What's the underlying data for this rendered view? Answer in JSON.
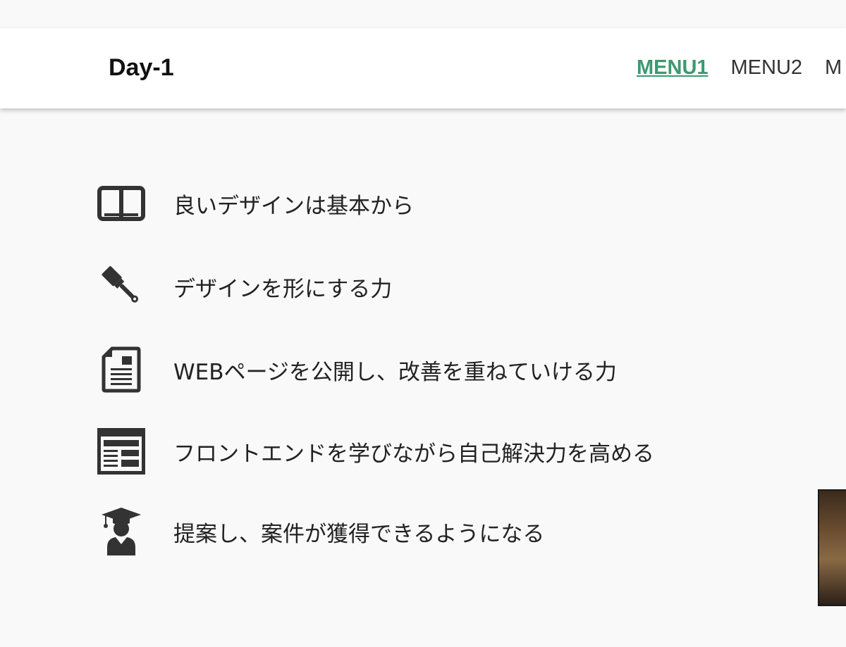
{
  "header": {
    "logo": "Day-1",
    "nav": [
      {
        "label": "MENU1",
        "active": true
      },
      {
        "label": "MENU2",
        "active": false
      },
      {
        "label": "M",
        "active": false
      }
    ]
  },
  "features": [
    {
      "icon": "book-icon",
      "text": "良いデザインは基本から"
    },
    {
      "icon": "paintbrush-icon",
      "text": "デザインを形にする力"
    },
    {
      "icon": "document-icon",
      "text": "WEBページを公開し、改善を重ねていける力"
    },
    {
      "icon": "webpage-layout-icon",
      "text": "フロントエンドを学びながら自己解決力を高める"
    },
    {
      "icon": "graduate-icon",
      "text": "提案し、案件が獲得できるようになる"
    }
  ],
  "colors": {
    "accent": "#3d9970",
    "text": "#222222",
    "icon": "#333333",
    "background": "#f9f9f9"
  }
}
